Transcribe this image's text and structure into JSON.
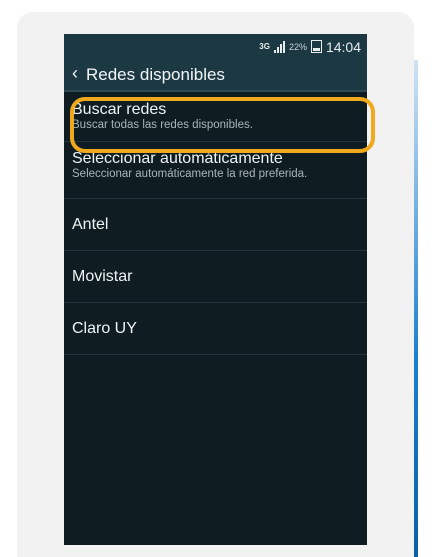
{
  "status": {
    "network": "3G",
    "battery_percent": "22%",
    "time": "14:04"
  },
  "header": {
    "back_icon": "chevron-left-icon",
    "title": "Redes disponibles"
  },
  "list": {
    "search": {
      "label": "Buscar redes",
      "description": "Buscar todas las redes disponibles."
    },
    "auto": {
      "label": "Seleccionar automáticamente",
      "description": "Seleccionar automáticamente la red preferida."
    },
    "networks": [
      "Antel",
      "Movistar",
      "Claro UY"
    ]
  },
  "colors": {
    "highlight": "#f0a81c",
    "header_bg": "#1c3843",
    "screen_bg": "#0f1d22"
  }
}
